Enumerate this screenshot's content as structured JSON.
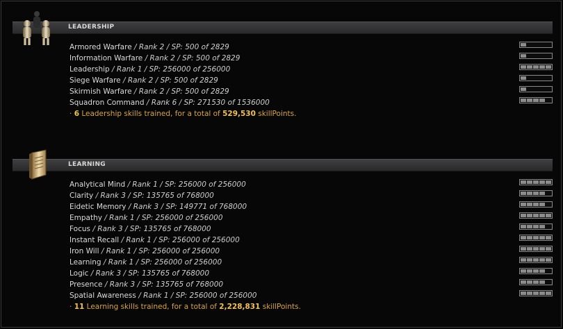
{
  "sections": [
    {
      "title": "LEADERSHIP",
      "icon": "leadership-figures-icon",
      "skills": [
        {
          "name": "Armored Warfare",
          "detail": " / Rank 2 / SP: 500 of 2829",
          "level": 1
        },
        {
          "name": "Information Warfare",
          "detail": " / Rank 2 / SP: 500 of 2829",
          "level": 1
        },
        {
          "name": "Leadership",
          "detail": " / Rank 1 / SP: 256000 of 256000",
          "level": 5
        },
        {
          "name": "Siege Warfare",
          "detail": " / Rank 2 / SP: 500 of 2829",
          "level": 1
        },
        {
          "name": "Skirmish Warfare",
          "detail": " / Rank 2 / SP: 500 of 2829",
          "level": 1
        },
        {
          "name": "Squadron Command",
          "detail": " / Rank 6 / SP: 271530 of 1536000",
          "level": 4
        }
      ],
      "summary": {
        "prefix": "· ",
        "count": "6",
        "middle": " Leadership skills trained, for a total of ",
        "total": "529,530",
        "suffix": " skillPoints."
      }
    },
    {
      "title": "LEARNING",
      "icon": "learning-book-icon",
      "skills": [
        {
          "name": "Analytical Mind",
          "detail": " / Rank 1 / SP: 256000 of 256000",
          "level": 5
        },
        {
          "name": "Clarity",
          "detail": " / Rank 3 / SP: 135765 of 768000",
          "level": 4
        },
        {
          "name": "Eidetic Memory",
          "detail": " / Rank 3 / SP: 149771 of 768000",
          "level": 4
        },
        {
          "name": "Empathy",
          "detail": " / Rank 1 / SP: 256000 of 256000",
          "level": 5
        },
        {
          "name": "Focus",
          "detail": " / Rank 3 / SP: 135765 of 768000",
          "level": 4
        },
        {
          "name": "Instant Recall",
          "detail": " / Rank 1 / SP: 256000 of 256000",
          "level": 5
        },
        {
          "name": "Iron Will",
          "detail": " / Rank 1 / SP: 256000 of 256000",
          "level": 5
        },
        {
          "name": "Learning",
          "detail": " / Rank 1 / SP: 256000 of 256000",
          "level": 5
        },
        {
          "name": "Logic",
          "detail": " / Rank 3 / SP: 135765 of 768000",
          "level": 4
        },
        {
          "name": "Presence",
          "detail": " / Rank 3 / SP: 135765 of 768000",
          "level": 4
        },
        {
          "name": "Spatial Awareness",
          "detail": " / Rank 1 / SP: 256000 of 256000",
          "level": 5
        }
      ],
      "summary": {
        "prefix": "· ",
        "count": "11",
        "middle": " Learning skills trained, for a total of ",
        "total": "2,228,831",
        "suffix": " skillPoints."
      }
    }
  ]
}
